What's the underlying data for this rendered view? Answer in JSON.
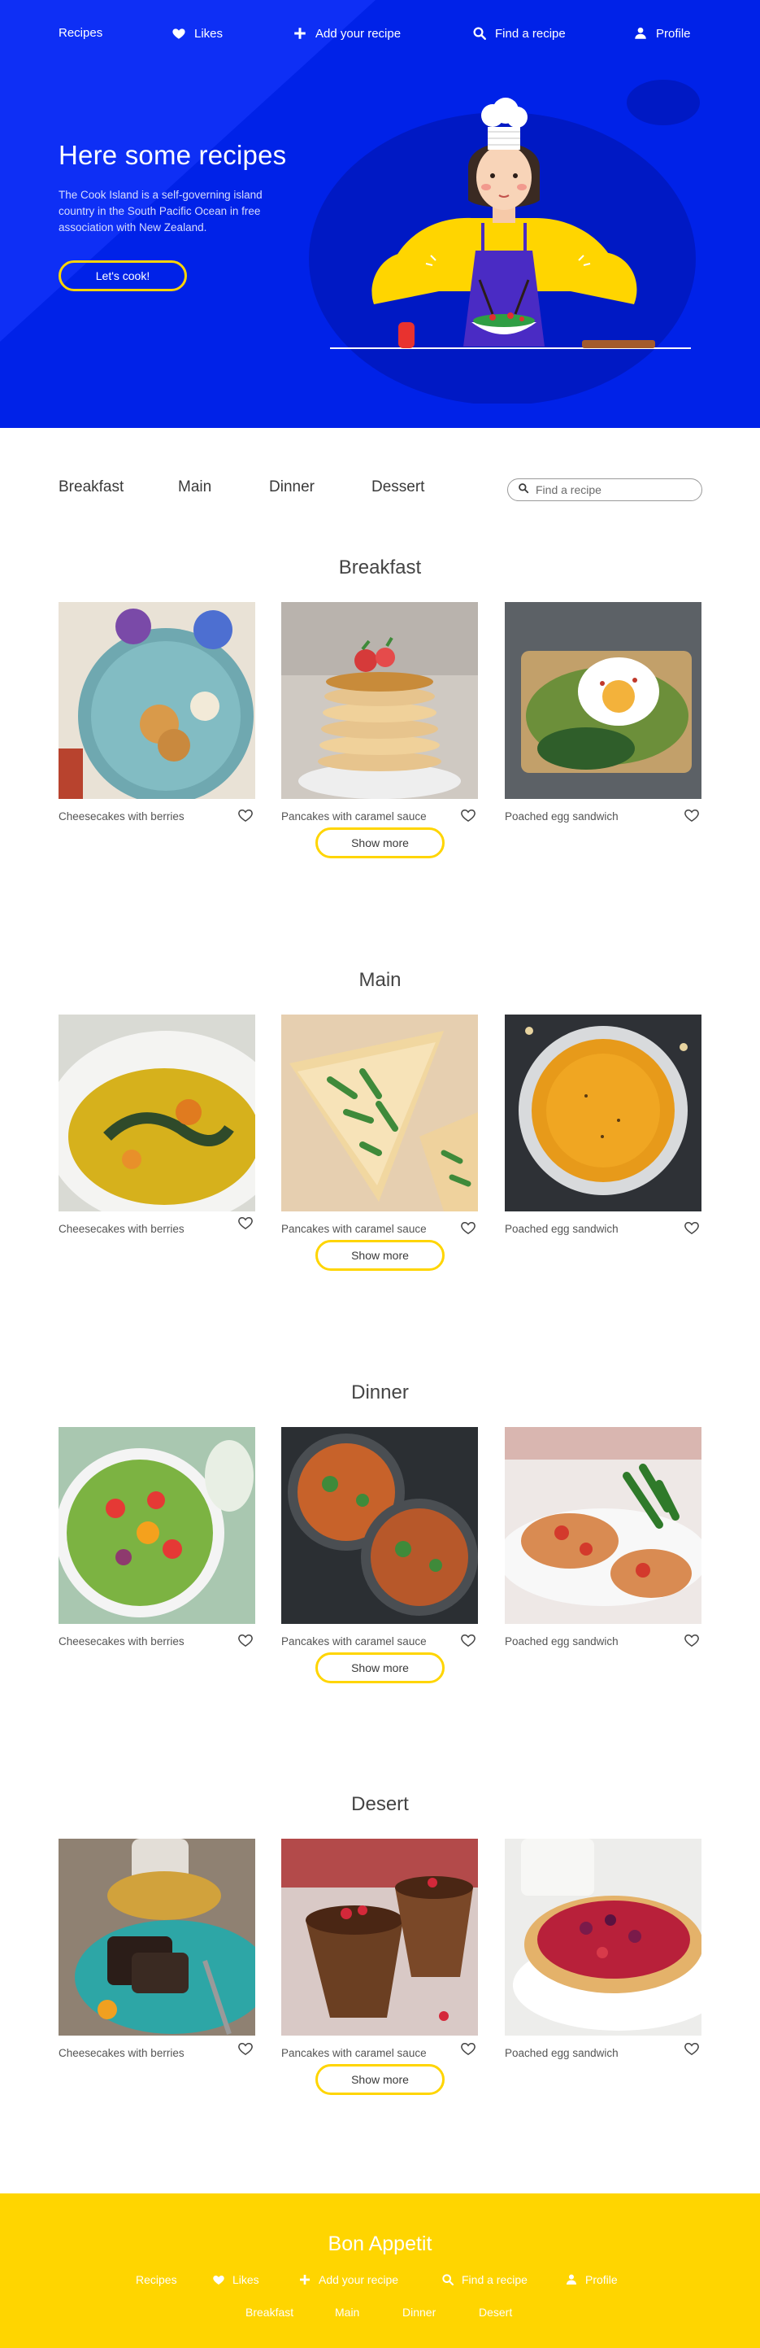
{
  "nav": {
    "recipes": "Recipes",
    "likes": "Likes",
    "add_recipe": "Add your recipe",
    "find_recipe": "Find a recipe",
    "profile": "Profile"
  },
  "hero": {
    "title": "Here some recipes",
    "text": "The Cook Island is a self-governing island country in the South Pacific Ocean in free association with New Zealand.",
    "cta": "Let's cook!"
  },
  "filters": {
    "tabs": [
      "Breakfast",
      "Main",
      "Dinner",
      "Dessert"
    ],
    "search_placeholder": "Find a recipe"
  },
  "sections": [
    {
      "title": "Breakfast",
      "cards": [
        {
          "caption": "Cheesecakes with berries"
        },
        {
          "caption": "Pancakes with caramel sauce"
        },
        {
          "caption": "Poached egg sandwich"
        }
      ],
      "show_more": "Show more"
    },
    {
      "title": "Main",
      "cards": [
        {
          "caption": "Cheesecakes with berries"
        },
        {
          "caption": "Pancakes with caramel sauce"
        },
        {
          "caption": "Poached egg sandwich"
        }
      ],
      "show_more": "Show more"
    },
    {
      "title": "Dinner",
      "cards": [
        {
          "caption": "Cheesecakes with berries"
        },
        {
          "caption": "Pancakes with caramel sauce"
        },
        {
          "caption": "Poached egg sandwich"
        }
      ],
      "show_more": "Show more"
    },
    {
      "title": "Desert",
      "cards": [
        {
          "caption": "Cheesecakes with berries"
        },
        {
          "caption": "Pancakes with caramel sauce"
        },
        {
          "caption": "Poached egg sandwich"
        }
      ],
      "show_more": "Show more"
    }
  ],
  "footer": {
    "title": "Bon Appetit",
    "nav": {
      "recipes": "Recipes",
      "likes": "Likes",
      "add_recipe": "Add your recipe",
      "find_recipe": "Find a recipe",
      "profile": "Profile"
    },
    "categories": [
      "Breakfast",
      "Main",
      "Dinner",
      "Desert"
    ]
  },
  "colors": {
    "brand_blue": "#0022e8",
    "accent_yellow": "#ffd500"
  },
  "icons": {
    "likes": "heart-icon",
    "add": "plus-icon",
    "find": "search-icon",
    "profile": "user-icon",
    "favorite": "heart-outline-icon"
  }
}
